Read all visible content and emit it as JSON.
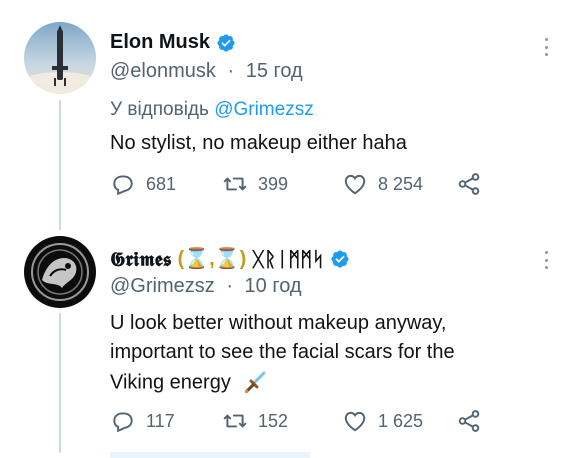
{
  "tweets": [
    {
      "display_name": "Elon Musk",
      "handle": "@elonmusk",
      "separator": "·",
      "time": "15 год",
      "reply_prefix": "У відповідь",
      "reply_mention": "@Grimezsz",
      "text_lines": [
        "No stylist, no makeup either haha"
      ],
      "replies": "681",
      "retweets": "399",
      "likes": "8 254",
      "verified": true,
      "avatar_icon": "starship-avatar"
    },
    {
      "display_name_prefix": "𝕲𝖗𝖎𝖒𝖊𝖘",
      "display_name_mid": "(⌛,⌛)",
      "display_name_suffix": "ᚷᚱᛁᛗᛗᛋ",
      "handle": "@Grimezsz",
      "separator": "·",
      "time": "10 год",
      "text_lines": [
        "U look better without makeup anyway,",
        "important to see the facial scars for the",
        "Viking energy"
      ],
      "replies": "117",
      "retweets": "152",
      "likes": "1 625",
      "verified": true,
      "avatar_icon": "grimes-avatar",
      "trailing_emoji": "dagger-emoji"
    }
  ],
  "colors": {
    "text": "#0f1419",
    "secondary": "#536471",
    "link": "#1d9bf0",
    "verified": "#1d9bf0",
    "thread_line": "#cfd9de"
  }
}
